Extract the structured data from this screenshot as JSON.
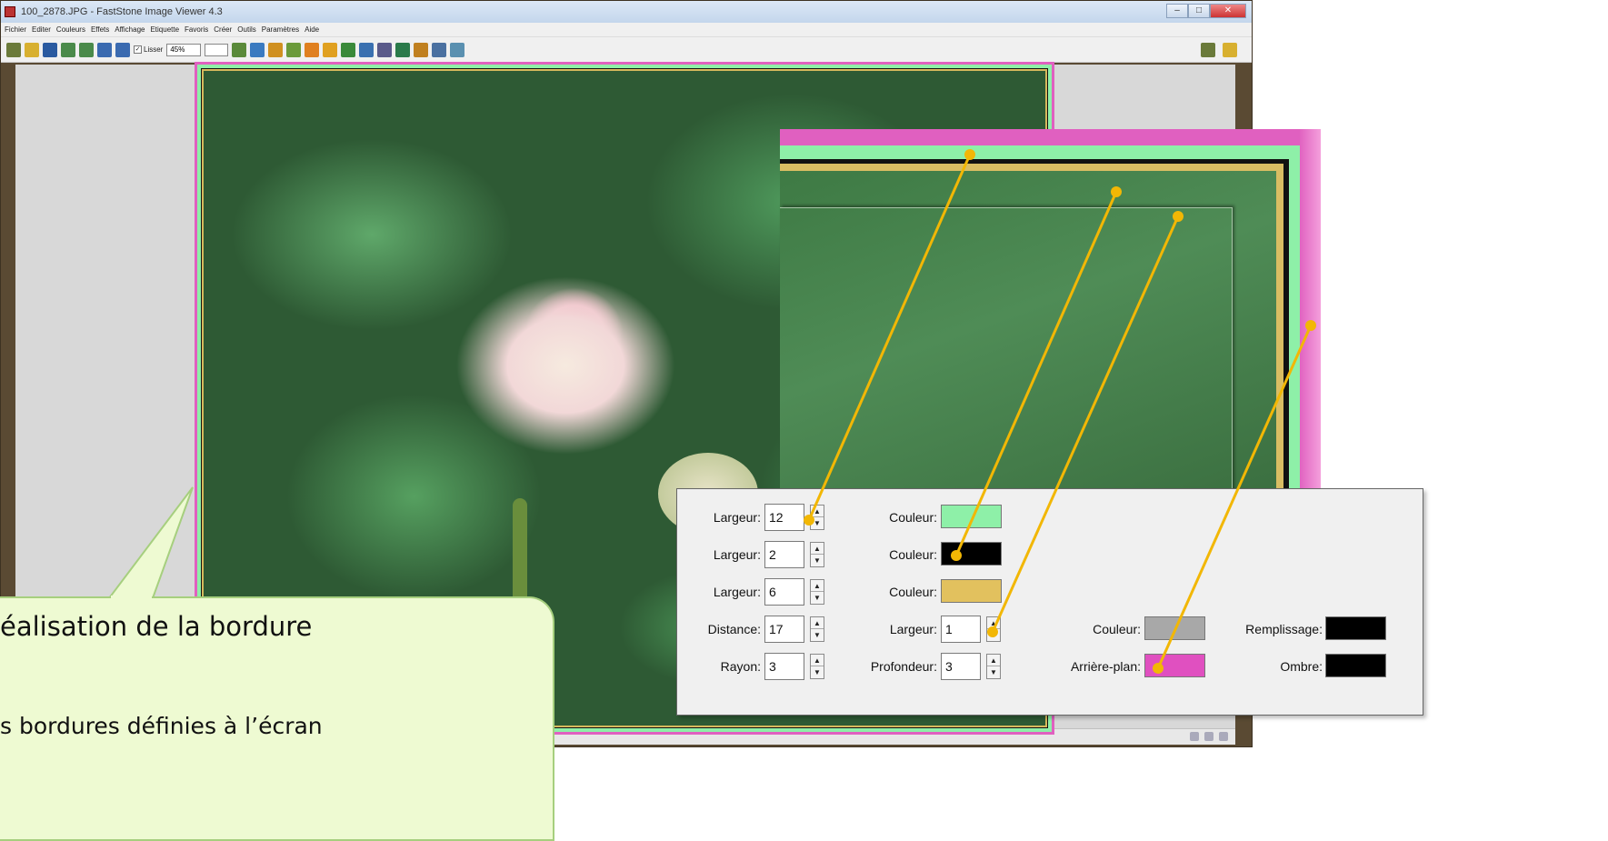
{
  "window": {
    "title": "100_2878.JPG - FastStone Image Viewer 4.3",
    "controls": [
      "–",
      "□",
      "✕"
    ]
  },
  "menu": [
    "Fichier",
    "Editer",
    "Couleurs",
    "Effets",
    "Affichage",
    "Etiquette",
    "Favoris",
    "Créer",
    "Outils",
    "Paramètres",
    "Aide"
  ],
  "toolbar": {
    "smooth_label": "Lisser",
    "smooth_checked": "✓",
    "zoom_value": "45%",
    "icon_colors": [
      "#6a7a3a",
      "#d8b030",
      "#2a5aa0",
      "#4a8a4a",
      "#4a8a4a",
      "#3a6ab0",
      "#3a6ab0",
      "#5a8a3a",
      "#3a7ac0",
      "#d09020",
      "#6a9a3a",
      "#e08020",
      "#e0a020",
      "#3a8a3a",
      "#3a70b0",
      "#5a5a8a",
      "#2a7a4a",
      "#c08020",
      "#4a70a0",
      "#5a90b0"
    ]
  },
  "settings": {
    "rows": [
      {
        "label": "Largeur:",
        "value": "12",
        "color_label": "Couleur:",
        "color": "#8ef0a8"
      },
      {
        "label": "Largeur:",
        "value": "2",
        "color_label": "Couleur:",
        "color": "#000000"
      },
      {
        "label": "Largeur:",
        "value": "6",
        "color_label": "Couleur:",
        "color": "#e2c15e"
      },
      {
        "label": "Distance:",
        "value": "17",
        "sub_label": "Largeur:",
        "sub_value": "1",
        "color_label": "Couleur:",
        "color": "#a8a8a8",
        "extra_label": "Remplissage:",
        "extra_color": "#000000"
      },
      {
        "label": "Rayon:",
        "value": "3",
        "sub_label": "Profondeur:",
        "sub_value": "3",
        "color_label": "Arrière-plan:",
        "color": "#e050c0",
        "extra_label": "Ombre:",
        "extra_color": "#000000"
      }
    ],
    "spin_up": "▲",
    "spin_down": "▼"
  },
  "callout": {
    "title": "éalisation de la bordure",
    "text": "s bordures définies à l’écran"
  },
  "colors": {
    "leader": "#f2b705",
    "outer_border": "#e060c0",
    "green_border": "#8ef0a8",
    "gold_border": "#d9bd63"
  }
}
